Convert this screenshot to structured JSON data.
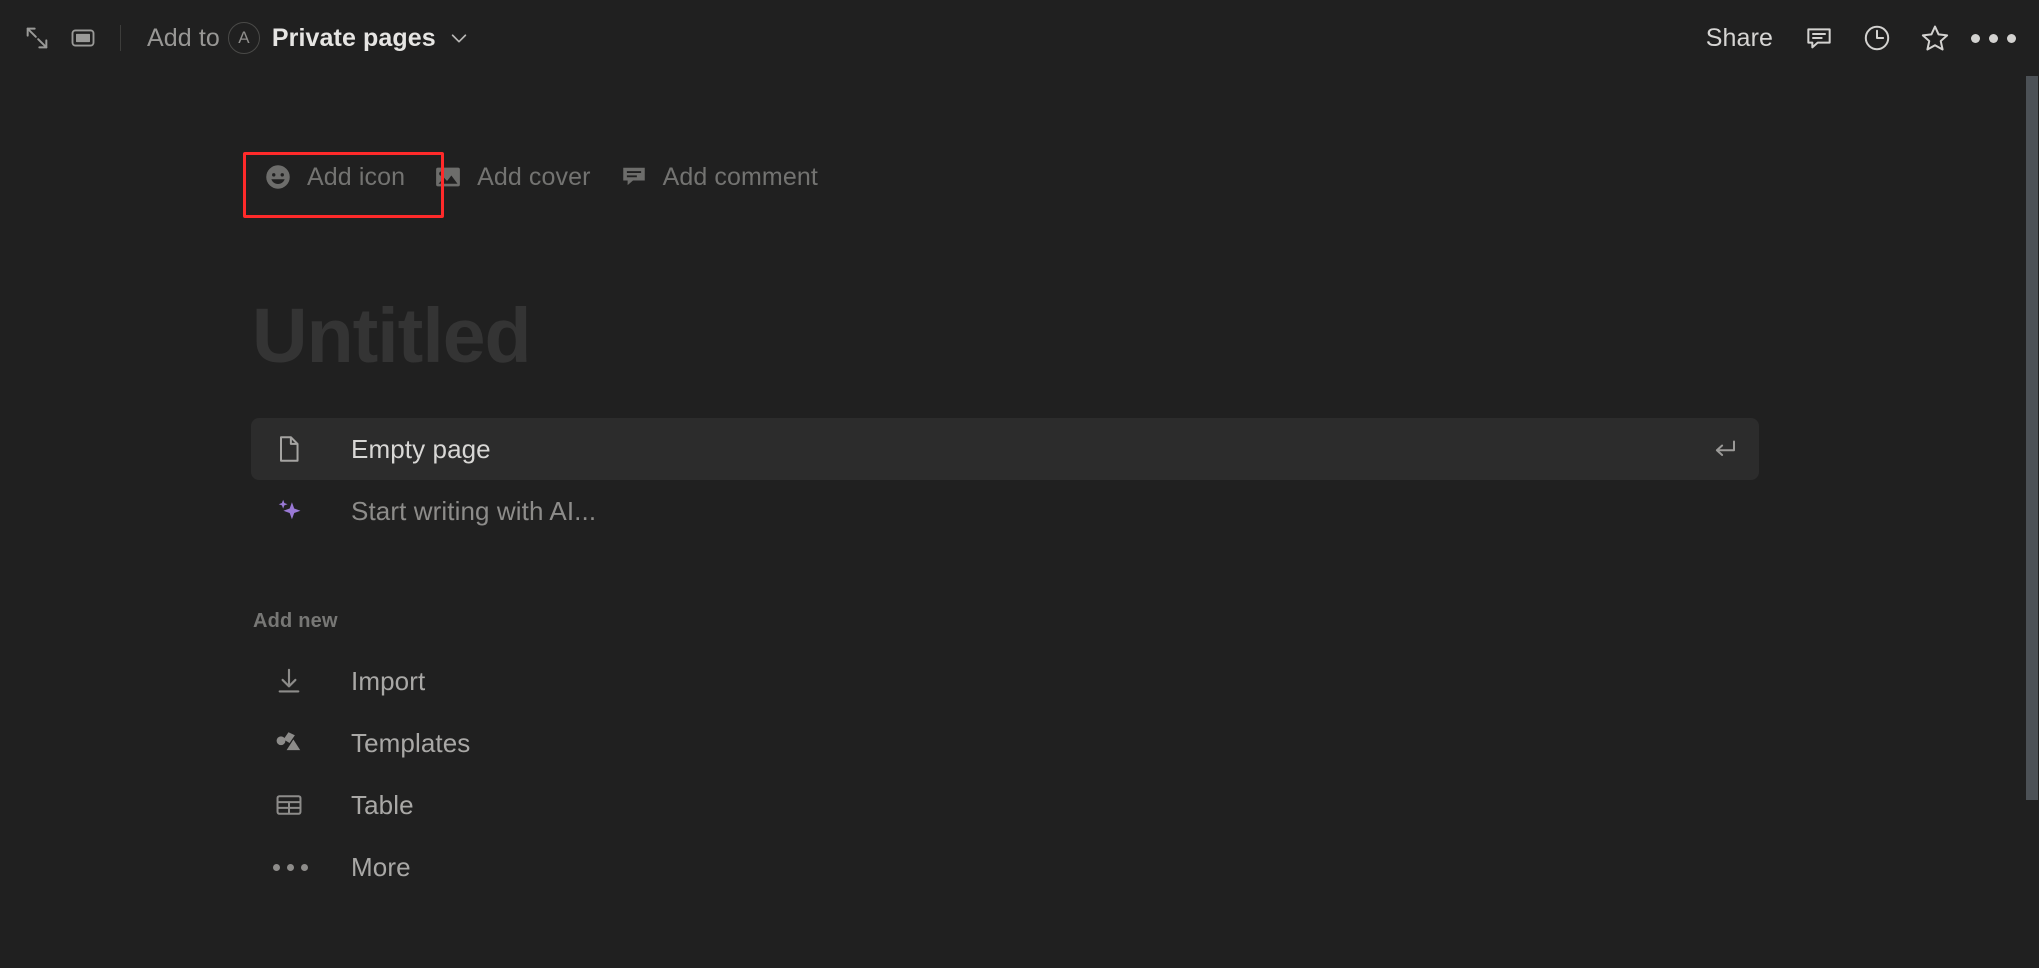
{
  "topbar": {
    "expand_icon": "expand-diagonal-icon",
    "panel_icon": "sidebar-panel-icon",
    "add_to_label": "Add to",
    "avatar_initial": "A",
    "breadcrumb_title": "Private pages",
    "chevron_icon": "chevron-down-icon",
    "share_label": "Share",
    "comment_icon": "comment-icon",
    "history_icon": "clock-history-icon",
    "favorite_icon": "star-icon",
    "more_icon": "more-horizontal-icon"
  },
  "page": {
    "title": "Untitled",
    "actions": [
      {
        "label": "Add icon",
        "icon": "emoji-smiley-icon",
        "highlighted": true
      },
      {
        "label": "Add cover",
        "icon": "image-icon",
        "highlighted": false
      },
      {
        "label": "Add comment",
        "icon": "comment-icon",
        "highlighted": false
      }
    ],
    "suggestions": [
      {
        "label": "Empty page",
        "icon": "page-document-icon",
        "active": true,
        "key_hint": "enter-key-icon"
      },
      {
        "label": "Start writing with AI...",
        "icon": "ai-sparkle-icon",
        "active": false,
        "key_hint": ""
      }
    ],
    "add_new": {
      "section_label": "Add new",
      "items": [
        {
          "label": "Import",
          "icon": "download-import-icon"
        },
        {
          "label": "Templates",
          "icon": "templates-shapes-icon"
        },
        {
          "label": "Table",
          "icon": "table-grid-icon"
        },
        {
          "label": "More",
          "icon": "more-horizontal-icon"
        }
      ]
    }
  },
  "annotation": {
    "target": "Add icon",
    "color": "#ff2a2a"
  },
  "colors": {
    "background": "#202020",
    "row_hover": "#2c2c2c",
    "accent_ai": "#9a79d6",
    "scrollbar": "#4c5156",
    "highlight": "#ff2a2a"
  }
}
